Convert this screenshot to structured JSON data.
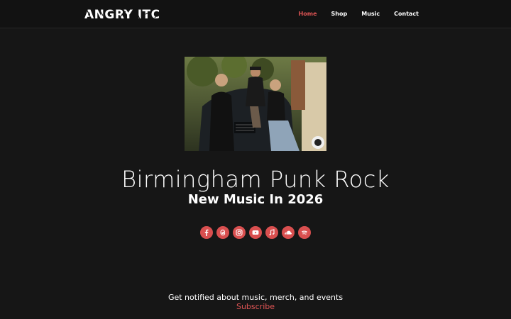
{
  "brand": {
    "name": "ANGRY ITCH"
  },
  "nav": {
    "items": [
      {
        "label": "Home",
        "active": true
      },
      {
        "label": "Shop",
        "active": false
      },
      {
        "label": "Music",
        "active": false
      },
      {
        "label": "Contact",
        "active": false
      }
    ]
  },
  "hero": {
    "title": "Birmingham Punk Rock",
    "subtitle": "New Music In 2026"
  },
  "socials": [
    {
      "icon": "facebook-icon"
    },
    {
      "icon": "threads-icon"
    },
    {
      "icon": "instagram-icon"
    },
    {
      "icon": "youtube-icon"
    },
    {
      "icon": "apple-music-icon"
    },
    {
      "icon": "soundcloud-icon"
    },
    {
      "icon": "spotify-icon"
    }
  ],
  "footer": {
    "notify_text": "Get notified about music, merch, and events",
    "subscribe_label": "Subscribe"
  },
  "colors": {
    "background": "#161616",
    "header": "#121212",
    "accent": "#e05555",
    "social_bg": "#d94f4f"
  }
}
